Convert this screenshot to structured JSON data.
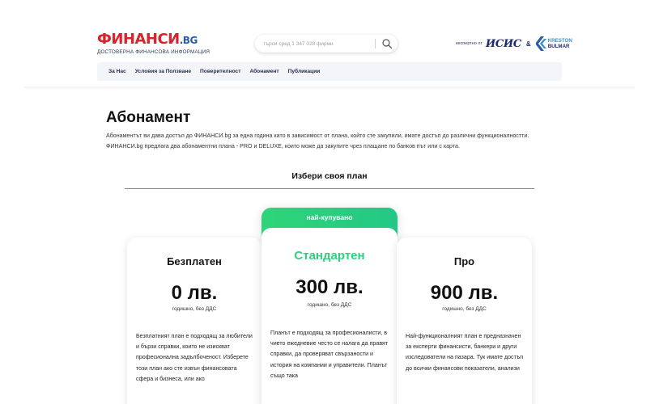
{
  "header": {
    "logo_main": "ФИНАНСИ",
    "logo_tld": ".BG",
    "logo_tagline": "ДОСТОВЕРНА ФИНАНСОВА ИНФОРМАЦИЯ",
    "search_placeholder": "търси сред 1 347 028 фирми",
    "partner_text": "експертно от",
    "partner_isis": "ИСИС",
    "partner_amp": "&",
    "partner_kreston_1": "KRESTON",
    "partner_kreston_2": "BULMAR"
  },
  "nav": {
    "items": [
      "За Нас",
      "Условия за Ползване",
      "Поверителност",
      "Абонамент",
      "Публикации"
    ]
  },
  "main": {
    "title": "Абонамент",
    "intro_1": "Абонаментът ви дава достъп до ФИНАНСИ.bg за една година като в зависимост от плана, който сте закупили, имате достъп до различни функционалностти.",
    "intro_2": "ФИНАНСИ.bg предлага два абонаментни плана - PRO и DELUXE, които може да закупите чрез плащане по банков път или с карта.",
    "choose_title": "Избери своя план"
  },
  "plans": [
    {
      "name": "Безплатен",
      "price": "0 лв.",
      "period": "годишно, без ДДС",
      "desc": "Безплатният план е подходящ за любители и бързи справки, които не изискват професионална задълбоченост. Изберете този план ако сте извън финансовата сфера и бизнеса, или ако"
    },
    {
      "badge": "най-купувано",
      "name": "Стандартен",
      "price": "300 лв.",
      "period": "годишно, без ДДС",
      "desc": "Планът е подходящ за професионалисти, в чието ежедневие често се налага да правят справки, да проверяват свързаности и история на компании и управители. Планът също така"
    },
    {
      "name": "Про",
      "price": "900 лв.",
      "period": "годишно, без ДДС",
      "desc": "Най-функционалният план е предназначен за експерти финансисти, банкери и други изследователи на пазара. Тук имате достъп до всички финансови показатели, анализи"
    }
  ],
  "colors": {
    "brand_red": "#d9232d",
    "brand_blue": "#2b5ca8",
    "accent_green": "#2fcf7e",
    "nav_bg": "#f3f5f8"
  }
}
